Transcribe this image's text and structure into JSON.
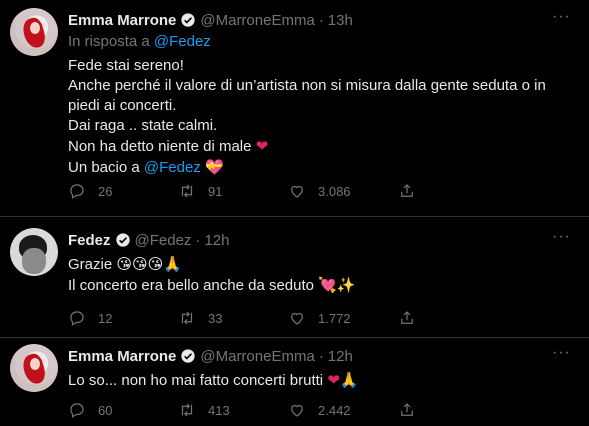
{
  "tweets": [
    {
      "name": "Emma Marrone",
      "handle": "@MarroneEmma",
      "time": "13h",
      "replying_prefix": "In risposta a",
      "replying_to": "@Fedez",
      "lines": [
        "Fede stai sereno!",
        "Anche perché il valore di un’artista non si misura dalla gente seduta o in",
        "piedi ai concerti.",
        "Dai raga .. state calmi.",
        "Non ha detto niente di male"
      ],
      "last_line_prefix": "Un bacio a",
      "last_line_link": "@Fedez",
      "reply_count": "26",
      "retweet_count": "91",
      "like_count": "3.086"
    },
    {
      "name": "Fedez",
      "handle": "@Fedez",
      "time": "12h",
      "lines": [
        "Grazie",
        "Il concerto era bello anche da seduto"
      ],
      "reply_count": "12",
      "retweet_count": "33",
      "like_count": "1.772"
    },
    {
      "name": "Emma Marrone",
      "handle": "@MarroneEmma",
      "time": "12h",
      "lines": [
        "Lo so... non ho mai fatto concerti brutti"
      ],
      "reply_count": "60",
      "retweet_count": "413",
      "like_count": "2.442"
    }
  ],
  "ui": {
    "separator": "·",
    "more": "···",
    "accent_color": "#1d9bf0",
    "heart_color": "#e0245e",
    "icons": [
      "reply-icon",
      "retweet-icon",
      "like-icon",
      "share-icon",
      "verified-icon",
      "more-icon"
    ]
  }
}
